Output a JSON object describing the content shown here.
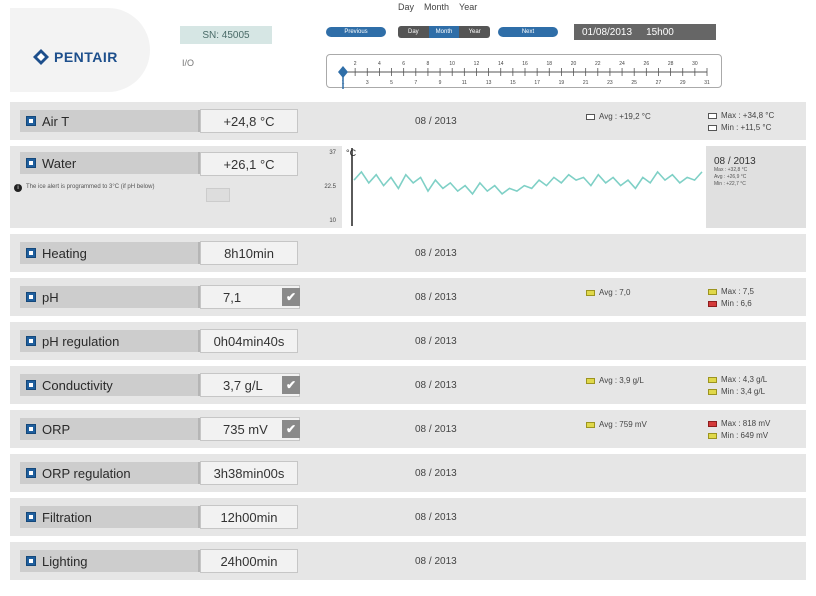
{
  "header": {
    "brand": "PENTAIR",
    "serial": "SN: 45005",
    "io_label": "I/O",
    "nav": {
      "tabs": [
        "Day",
        "Month",
        "Year"
      ],
      "prev": "Previous",
      "next": "Next",
      "slider": [
        "Day",
        "Month",
        "Year"
      ]
    },
    "datetime": {
      "date": "01/08/2013",
      "time": "15h00"
    },
    "ruler": {
      "top": [
        "2",
        "4",
        "6",
        "8",
        "10",
        "12",
        "14",
        "16",
        "18",
        "20",
        "22",
        "24",
        "26",
        "28",
        "30"
      ],
      "bottom": [
        "1",
        "3",
        "5",
        "7",
        "9",
        "11",
        "13",
        "15",
        "17",
        "19",
        "21",
        "23",
        "25",
        "27",
        "29",
        "31"
      ]
    }
  },
  "rows": [
    {
      "label": "Air T",
      "value": "+24,8 °C",
      "period": "08 / 2013",
      "avg": "Avg : +19,2 °C",
      "max": "Max : +34,8 °C",
      "min": "Min : +11,5 °C",
      "avg_flag": "white",
      "max_flag": "white",
      "min_flag": "white"
    },
    {
      "label": "Water",
      "value": "+26,1 °C",
      "warning": "The ice alert is programmed to 3°C (if pH below)",
      "chart_side": {
        "period": "08 / 2013",
        "max": "Max : +32,8 °C",
        "avg": "Avg : +26,9 °C",
        "min": "Min : +22,7 °C"
      }
    },
    {
      "label": "Heating",
      "value": "8h10min",
      "period": "08 / 2013"
    },
    {
      "label": "pH",
      "value": "7,1",
      "checked": true,
      "period": "08 / 2013",
      "avg": "Avg : 7,0",
      "max": "Max : 7,5",
      "min": "Min : 6,6",
      "avg_flag": "yellow",
      "max_flag": "yellow",
      "min_flag": "red"
    },
    {
      "label": "pH regulation",
      "value": "0h04min40s",
      "period": "08 / 2013"
    },
    {
      "label": "Conductivity",
      "value": "3,7 g/L",
      "checked": true,
      "period": "08 / 2013",
      "avg": "Avg : 3,9 g/L",
      "max": "Max : 4,3 g/L",
      "min": "Min : 3,4 g/L",
      "avg_flag": "yellow",
      "max_flag": "yellow",
      "min_flag": "yellow"
    },
    {
      "label": "ORP",
      "value": "735 mV",
      "checked": true,
      "period": "08 / 2013",
      "avg": "Avg : 759 mV",
      "max": "Max : 818 mV",
      "min": "Min : 649 mV",
      "avg_flag": "yellow",
      "max_flag": "red",
      "min_flag": "yellow"
    },
    {
      "label": "ORP regulation",
      "value": "3h38min00s",
      "period": "08 / 2013"
    },
    {
      "label": "Filtration",
      "value": "12h00min",
      "period": "08 / 2013"
    },
    {
      "label": "Lighting",
      "value": "24h00min",
      "period": "08 / 2013"
    }
  ],
  "water_chart": {
    "y_ticks": [
      "37",
      "22.5",
      "10"
    ],
    "unit": "°C",
    "series": [
      26,
      29,
      25,
      28,
      24,
      27,
      23,
      28,
      25,
      27,
      22,
      26,
      23,
      25,
      22,
      24,
      21,
      25,
      22,
      24,
      21,
      23,
      22,
      24,
      23,
      26,
      24,
      27,
      25,
      28,
      26,
      27,
      24,
      28,
      25,
      27,
      24,
      26,
      23,
      27,
      25,
      29,
      26,
      28,
      25,
      27,
      26,
      29
    ]
  },
  "colors": {
    "accent": "#2f6ea8",
    "series": "#7fd0c6",
    "row_bg": "#e6e6e6"
  }
}
